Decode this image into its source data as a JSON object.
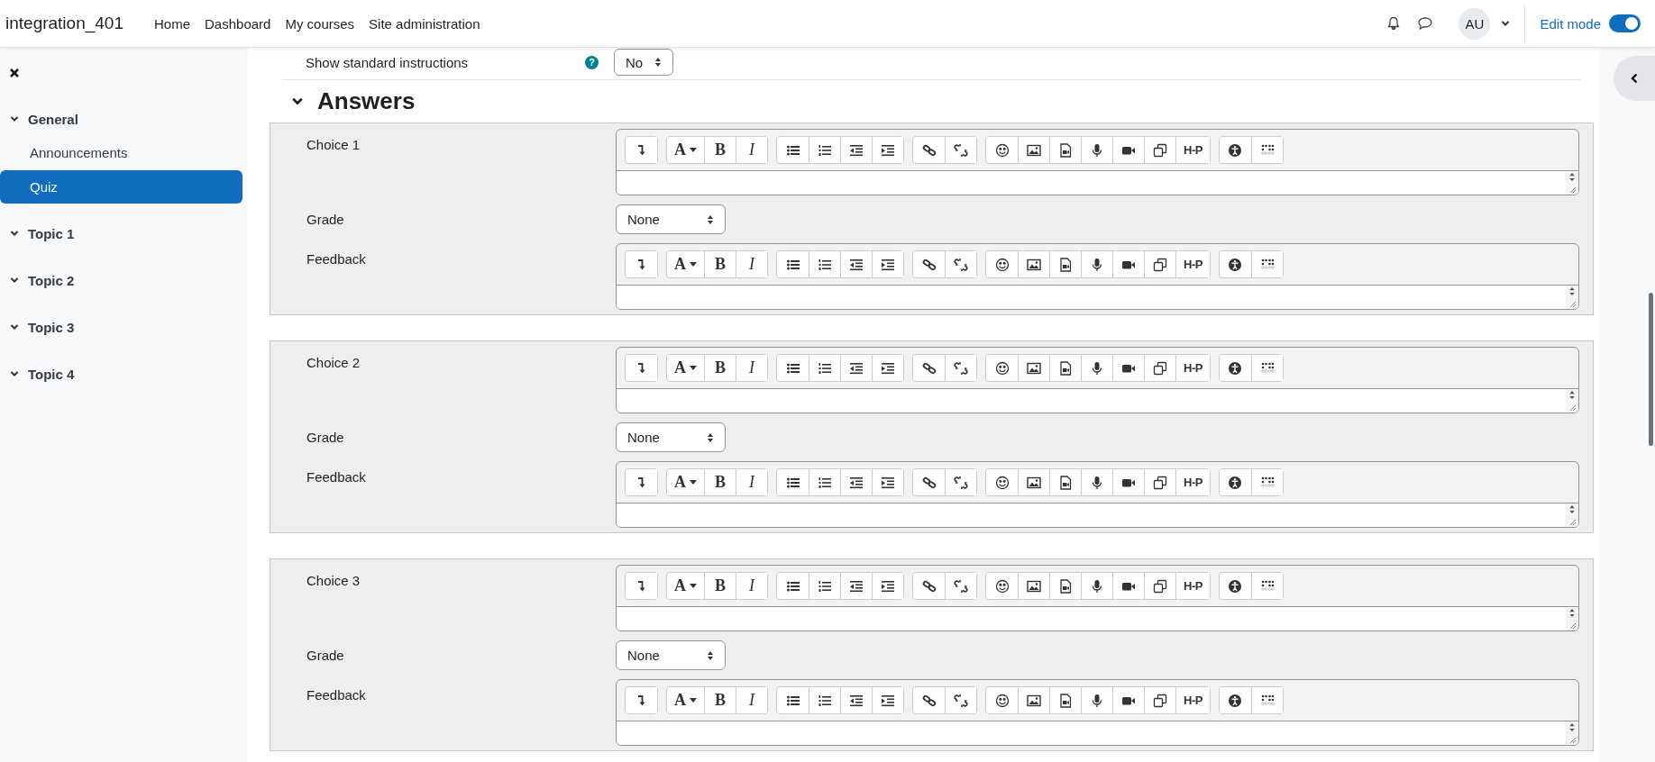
{
  "site_name": "integration_401",
  "nav": [
    {
      "label": "Home"
    },
    {
      "label": "Dashboard"
    },
    {
      "label": "My courses"
    },
    {
      "label": "Site administration"
    }
  ],
  "user": {
    "initials": "AU"
  },
  "edit_mode": {
    "label": "Edit mode",
    "on": true
  },
  "sidebar": {
    "items": [
      {
        "label": "General",
        "expanded": true,
        "children": [
          {
            "label": "Announcements",
            "selected": false
          },
          {
            "label": "Quiz",
            "selected": true
          }
        ]
      },
      {
        "label": "Topic 1",
        "expanded": true
      },
      {
        "label": "Topic 2",
        "expanded": true
      },
      {
        "label": "Topic 3",
        "expanded": true
      },
      {
        "label": "Topic 4",
        "expanded": true
      }
    ]
  },
  "instructions": {
    "label": "Show standard instructions",
    "help": "?",
    "value": "No"
  },
  "toolbar_groups": [
    [
      {
        "kind": "toggle"
      }
    ],
    [
      {
        "kind": "font"
      },
      {
        "kind": "bold"
      },
      {
        "kind": "italic"
      }
    ],
    [
      {
        "kind": "bullets"
      },
      {
        "kind": "numbers"
      },
      {
        "kind": "outdent"
      },
      {
        "kind": "indent"
      }
    ],
    [
      {
        "kind": "link"
      },
      {
        "kind": "unlink"
      }
    ],
    [
      {
        "kind": "emoji"
      },
      {
        "kind": "image"
      },
      {
        "kind": "media"
      },
      {
        "kind": "mic"
      },
      {
        "kind": "video"
      },
      {
        "kind": "copy"
      },
      {
        "kind": "h5p"
      }
    ],
    [
      {
        "kind": "accessibility"
      },
      {
        "kind": "braille"
      }
    ]
  ],
  "answers": {
    "title": "Answers",
    "expanded": true,
    "choices": [
      {
        "label": "Choice 1",
        "answer_keys": {
          "font": "A",
          "bold": "B",
          "italic": "I",
          "h5p": "H-P"
        },
        "grade_label": "Grade",
        "grade": "None",
        "feedback_label": "Feedback",
        "feedback_keys": {
          "font": "A",
          "bold": "B",
          "italic": "I",
          "h5p": "H-P"
        }
      },
      {
        "label": "Choice 2",
        "answer_keys": {
          "font": "A",
          "bold": "B",
          "italic": "I",
          "h5p": "H-P"
        },
        "grade_label": "Grade",
        "grade": "None",
        "feedback_label": "Feedback",
        "feedback_keys": {
          "font": "A",
          "bold": "B",
          "italic": "I",
          "h5p": "H-P"
        }
      },
      {
        "label": "Choice 3",
        "answer_keys": {
          "font": "A",
          "bold": "B",
          "italic": "I",
          "h5p": "H-P"
        },
        "grade_label": "Grade",
        "grade": "None",
        "feedback_label": "Feedback",
        "feedback_keys": {
          "font": "A",
          "bold": "B",
          "italic": "I",
          "h5p": "H-P"
        }
      }
    ]
  }
}
